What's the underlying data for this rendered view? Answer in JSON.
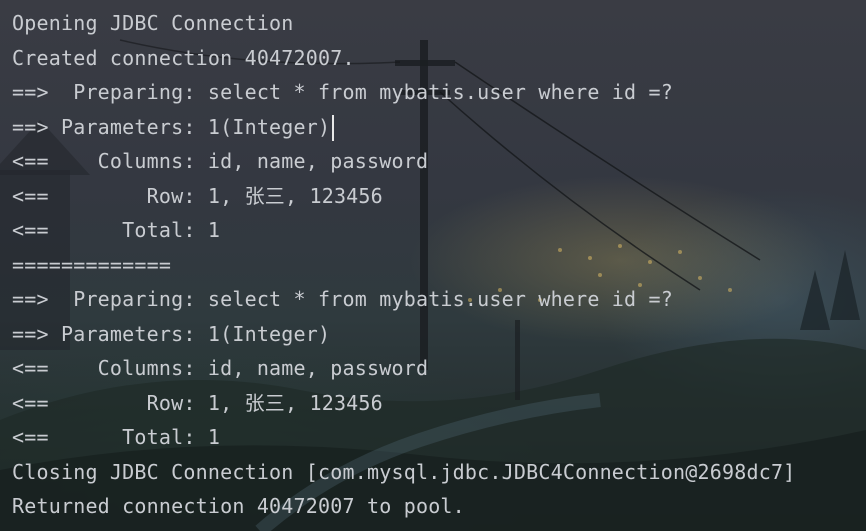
{
  "console": {
    "lines": [
      "Opening JDBC Connection",
      "Created connection 40472007.",
      "==>  Preparing: select * from mybatis.user where id =?",
      "==> Parameters: 1(Integer)",
      "<==    Columns: id, name, password",
      "<==        Row: 1, 张三, 123456",
      "<==      Total: 1",
      "=============",
      "==>  Preparing: select * from mybatis.user where id =?",
      "==> Parameters: 1(Integer)",
      "<==    Columns: id, name, password",
      "<==        Row: 1, 张三, 123456",
      "<==      Total: 1",
      "Closing JDBC Connection [com.mysql.jdbc.JDBC4Connection@2698dc7]",
      "Returned connection 40472007 to pool."
    ]
  }
}
